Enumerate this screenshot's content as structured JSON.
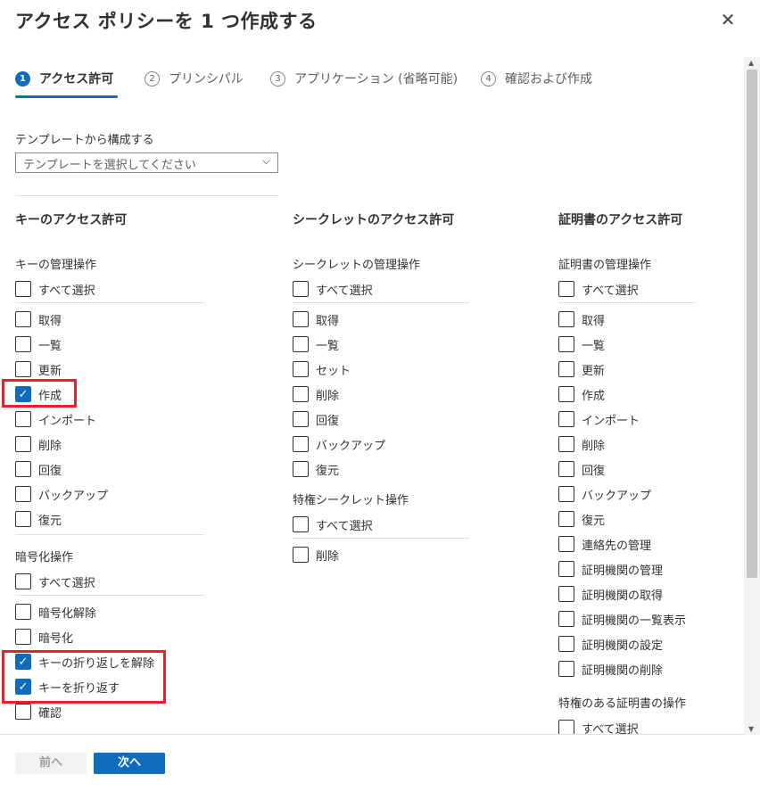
{
  "title": "アクセス ポリシーを 1 つ作成する",
  "steps": [
    {
      "num": "1",
      "label": "アクセス許可"
    },
    {
      "num": "2",
      "label": "プリンシパル"
    },
    {
      "num": "3",
      "label": "アプリケーション (省略可能)"
    },
    {
      "num": "4",
      "label": "確認および作成"
    }
  ],
  "template": {
    "label": "テンプレートから構成する",
    "placeholder": "テンプレートを選択してください"
  },
  "keys": {
    "heading": "キーのアクセス許可",
    "mgmt_label": "キーの管理操作",
    "mgmt_select_all": "すべて選択",
    "mgmt_items": [
      {
        "label": "取得",
        "checked": false
      },
      {
        "label": "一覧",
        "checked": false
      },
      {
        "label": "更新",
        "checked": false
      },
      {
        "label": "作成",
        "checked": true
      },
      {
        "label": "インポート",
        "checked": false
      },
      {
        "label": "削除",
        "checked": false
      },
      {
        "label": "回復",
        "checked": false
      },
      {
        "label": "バックアップ",
        "checked": false
      },
      {
        "label": "復元",
        "checked": false
      }
    ],
    "crypto_label": "暗号化操作",
    "crypto_select_all": "すべて選択",
    "crypto_items": [
      {
        "label": "暗号化解除",
        "checked": false
      },
      {
        "label": "暗号化",
        "checked": false
      },
      {
        "label": "キーの折り返しを解除",
        "checked": true
      },
      {
        "label": "キーを折り返す",
        "checked": true
      },
      {
        "label": "確認",
        "checked": false
      }
    ]
  },
  "secrets": {
    "heading": "シークレットのアクセス許可",
    "mgmt_label": "シークレットの管理操作",
    "mgmt_select_all": "すべて選択",
    "mgmt_items": [
      {
        "label": "取得",
        "checked": false
      },
      {
        "label": "一覧",
        "checked": false
      },
      {
        "label": "セット",
        "checked": false
      },
      {
        "label": "削除",
        "checked": false
      },
      {
        "label": "回復",
        "checked": false
      },
      {
        "label": "バックアップ",
        "checked": false
      },
      {
        "label": "復元",
        "checked": false
      }
    ],
    "priv_label": "特権シークレット操作",
    "priv_select_all": "すべて選択",
    "priv_items": [
      {
        "label": "削除",
        "checked": false
      }
    ]
  },
  "certs": {
    "heading": "証明書のアクセス許可",
    "mgmt_label": "証明書の管理操作",
    "mgmt_select_all": "すべて選択",
    "mgmt_items": [
      {
        "label": "取得",
        "checked": false
      },
      {
        "label": "一覧",
        "checked": false
      },
      {
        "label": "更新",
        "checked": false
      },
      {
        "label": "作成",
        "checked": false
      },
      {
        "label": "インポート",
        "checked": false
      },
      {
        "label": "削除",
        "checked": false
      },
      {
        "label": "回復",
        "checked": false
      },
      {
        "label": "バックアップ",
        "checked": false
      },
      {
        "label": "復元",
        "checked": false
      },
      {
        "label": "連絡先の管理",
        "checked": false
      },
      {
        "label": "証明機関の管理",
        "checked": false
      },
      {
        "label": "証明機関の取得",
        "checked": false
      },
      {
        "label": "証明機関の一覧表示",
        "checked": false
      },
      {
        "label": "証明機関の設定",
        "checked": false
      },
      {
        "label": "証明機関の削除",
        "checked": false
      }
    ],
    "priv_label": "特権のある証明書の操作",
    "priv_select_all": "すべて選択"
  },
  "footer": {
    "prev": "前へ",
    "next": "次へ"
  },
  "colors": {
    "accent": "#0f6cbd",
    "highlight": "#e8202a"
  }
}
